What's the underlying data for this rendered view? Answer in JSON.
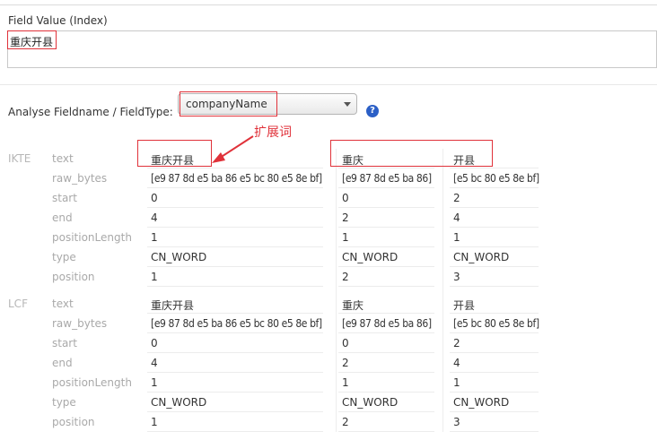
{
  "field_value": {
    "label": "Field Value (Index)",
    "value": "重庆开县"
  },
  "analyse": {
    "label": "Analyse Fieldname / FieldType:",
    "selected": "companyName",
    "help": "?"
  },
  "annotation": "扩展词",
  "sections": [
    {
      "name": "IKTE",
      "row_labels": [
        "text",
        "raw_bytes",
        "start",
        "end",
        "positionLength",
        "type",
        "position"
      ],
      "tokens": [
        {
          "text": "重庆开县",
          "raw_bytes": "[e9 87 8d e5 ba 86 e5 bc 80 e5 8e bf]",
          "start": "0",
          "end": "4",
          "positionLength": "1",
          "type": "CN_WORD",
          "position": "1"
        },
        {
          "text": "重庆",
          "raw_bytes": "[e9 87 8d e5 ba 86]",
          "start": "0",
          "end": "2",
          "positionLength": "1",
          "type": "CN_WORD",
          "position": "2"
        },
        {
          "text": "开县",
          "raw_bytes": "[e5 bc 80 e5 8e bf]",
          "start": "2",
          "end": "4",
          "positionLength": "1",
          "type": "CN_WORD",
          "position": "3"
        }
      ]
    },
    {
      "name": "LCF",
      "row_labels": [
        "text",
        "raw_bytes",
        "start",
        "end",
        "positionLength",
        "type",
        "position"
      ],
      "tokens": [
        {
          "text": "重庆开县",
          "raw_bytes": "[e9 87 8d e5 ba 86 e5 bc 80 e5 8e bf]",
          "start": "0",
          "end": "4",
          "positionLength": "1",
          "type": "CN_WORD",
          "position": "1"
        },
        {
          "text": "重庆",
          "raw_bytes": "[e9 87 8d e5 ba 86]",
          "start": "0",
          "end": "2",
          "positionLength": "1",
          "type": "CN_WORD",
          "position": "2"
        },
        {
          "text": "开县",
          "raw_bytes": "[e5 bc 80 e5 8e bf]",
          "start": "2",
          "end": "4",
          "positionLength": "1",
          "type": "CN_WORD",
          "position": "3"
        }
      ]
    }
  ]
}
